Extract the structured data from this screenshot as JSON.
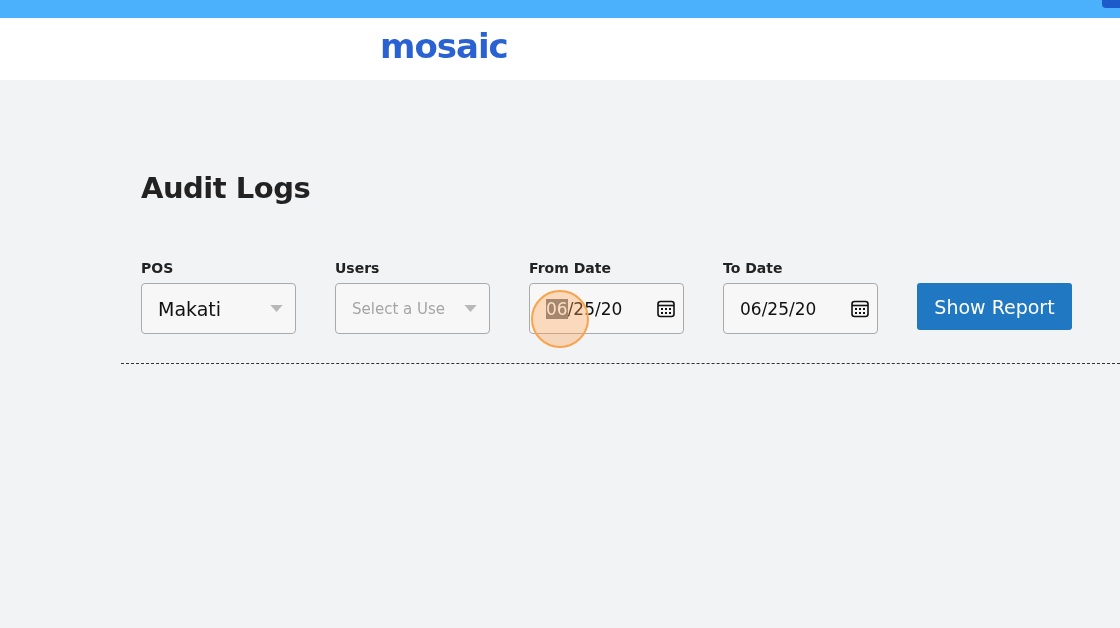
{
  "logo": "mosaic",
  "page": {
    "title": "Audit Logs"
  },
  "filters": [
    {
      "kind": "select",
      "label": "POS",
      "value": "Makati"
    },
    {
      "kind": "select",
      "label": "Users",
      "placeholder": "Select a Use"
    },
    {
      "kind": "date",
      "label": "From Date",
      "focused": true,
      "parts": [
        {
          "text": "06",
          "selected": true
        },
        {
          "text": "/25/20",
          "selected": false
        }
      ]
    },
    {
      "kind": "date",
      "label": "To Date",
      "focused": false,
      "parts": [
        {
          "text": "06",
          "selected": false
        },
        {
          "text": "/25/20",
          "selected": false
        }
      ]
    }
  ],
  "button": "Show Report"
}
